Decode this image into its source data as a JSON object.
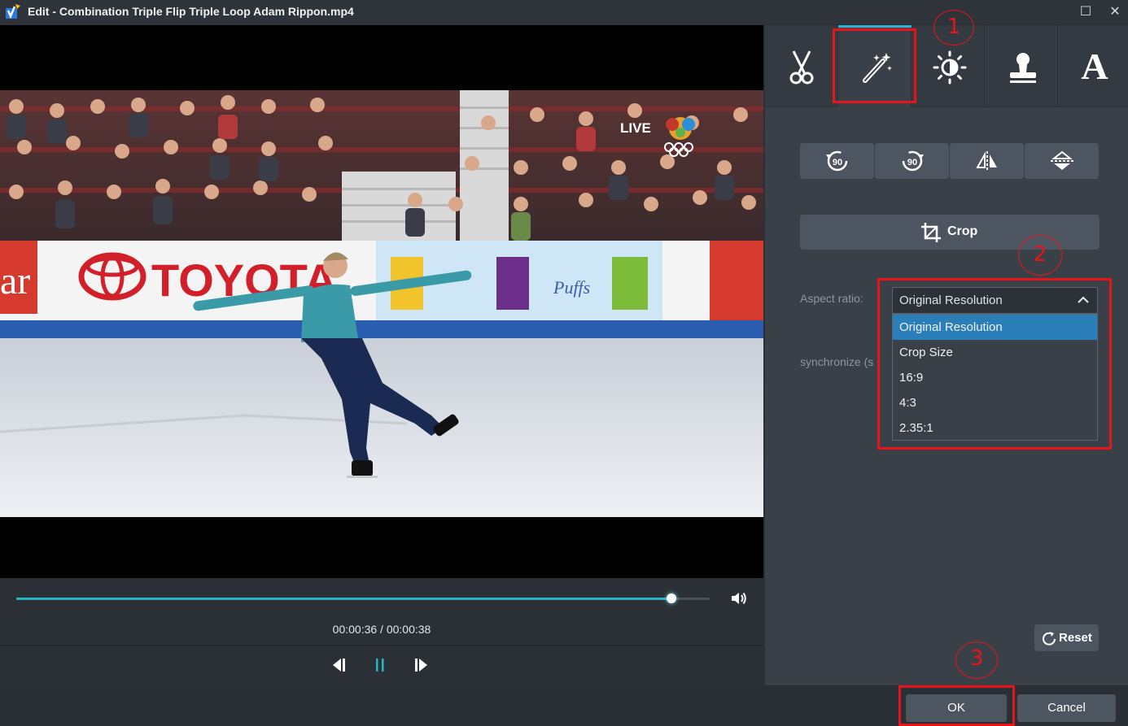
{
  "window": {
    "title": "Edit - Combination Triple Flip Triple Loop Adam Rippon.mp4",
    "maximize_symbol": "☐",
    "close_symbol": "✕"
  },
  "video": {
    "broadcast_label": "LIVE",
    "sponsor_text": "TOYOTA",
    "board_fragment": "ar",
    "product_brand": "Puffs"
  },
  "player": {
    "current_time": "00:00:36",
    "total_time": "00:00:38",
    "time_display": "00:00:36 / 00:00:38",
    "progress_fraction": 0.945
  },
  "tabs": [
    {
      "name": "cut",
      "icon": "scissors-icon",
      "active": false
    },
    {
      "name": "effects",
      "icon": "magic-wand-icon",
      "active": true
    },
    {
      "name": "adjust",
      "icon": "brightness-icon",
      "active": false
    },
    {
      "name": "watermark",
      "icon": "stamp-icon",
      "active": false
    },
    {
      "name": "text",
      "icon": "text-icon",
      "label": "A",
      "active": false
    }
  ],
  "rotate_buttons": [
    {
      "icon": "rotate-left-90-icon",
      "label": "90"
    },
    {
      "icon": "rotate-right-90-icon",
      "label": "90"
    },
    {
      "icon": "flip-horizontal-icon"
    },
    {
      "icon": "flip-vertical-icon"
    }
  ],
  "crop": {
    "label": "Crop",
    "icon": "crop-icon"
  },
  "aspect_ratio": {
    "label": "Aspect ratio:",
    "selected": "Original Resolution",
    "options": [
      "Original Resolution",
      "Crop Size",
      "16:9",
      "4:3",
      "2.35:1"
    ]
  },
  "synchronize": {
    "label": "synchronize (s"
  },
  "reset": {
    "label": "Reset"
  },
  "footer": {
    "ok_label": "OK",
    "cancel_label": "Cancel"
  },
  "annotations": [
    "1",
    "2",
    "3"
  ],
  "colors": {
    "accent": "#27b6c4",
    "selection": "#2b7fb8",
    "annotation": "#e8141a",
    "panel": "#3a4048"
  }
}
